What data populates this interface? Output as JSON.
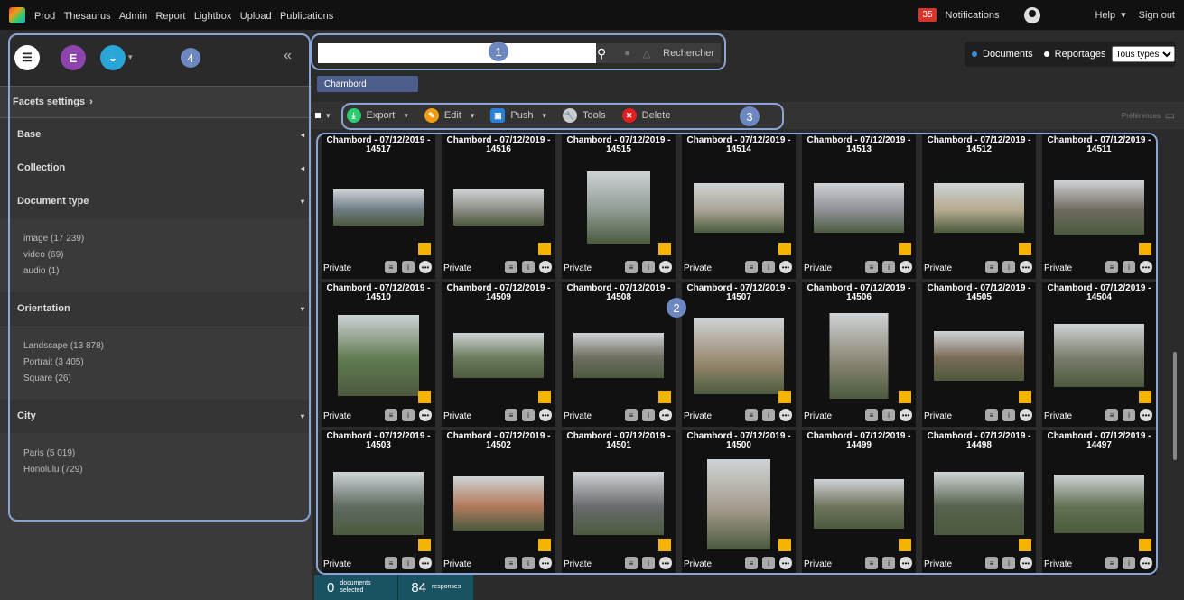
{
  "topbar": {
    "nav": [
      "Prod",
      "Thesaurus",
      "Admin",
      "Report",
      "Lightbox",
      "Upload",
      "Publications"
    ],
    "notifications_count": "35",
    "notifications_label": "Notifications",
    "help": "Help",
    "signout": "Sign out"
  },
  "annotations": {
    "n1": "1",
    "n2": "2",
    "n3": "3",
    "n4": "4"
  },
  "sidebar": {
    "facets_settings": "Facets settings",
    "collapse": "«",
    "facets": [
      {
        "label": "Base"
      },
      {
        "label": "Collection"
      },
      {
        "label": "Document type",
        "items": [
          "image (17 239)",
          "video (69)",
          "audio (1)"
        ]
      },
      {
        "label": "Orientation",
        "items": [
          "Landscape (13 878)",
          "Portrait (3 405)",
          "Square (26)"
        ]
      },
      {
        "label": "City",
        "items": [
          "Paris (5 019)",
          "Honolulu (729)"
        ]
      }
    ]
  },
  "search": {
    "placeholder": "",
    "button": "Rechercher"
  },
  "filters": {
    "documents": "Documents",
    "reportages": "Reportages",
    "type_select": "Tous types"
  },
  "active_chip": "Chambord",
  "toolbar": {
    "export": "Export",
    "edit": "Edit",
    "push": "Push",
    "tools": "Tools",
    "delete": "Delete",
    "preferences": "Préférences"
  },
  "results": {
    "cards": [
      {
        "t1": "Chambord - 07/12/2019 -",
        "t2": "14517",
        "priv": "Private"
      },
      {
        "t1": "Chambord - 07/12/2019 -",
        "t2": "14516",
        "priv": "Private"
      },
      {
        "t1": "Chambord - 07/12/2019 -",
        "t2": "14515",
        "priv": "Private"
      },
      {
        "t1": "Chambord - 07/12/2019 -",
        "t2": "14514",
        "priv": "Private"
      },
      {
        "t1": "Chambord - 07/12/2019 -",
        "t2": "14513",
        "priv": "Private"
      },
      {
        "t1": "Chambord - 07/12/2019 -",
        "t2": "14512",
        "priv": "Private"
      },
      {
        "t1": "Chambord - 07/12/2019 -",
        "t2": "14511",
        "priv": "Private"
      },
      {
        "t1": "Chambord - 07/12/2019 -",
        "t2": "14510",
        "priv": "Private"
      },
      {
        "t1": "Chambord - 07/12/2019 -",
        "t2": "14509",
        "priv": "Private"
      },
      {
        "t1": "Chambord - 07/12/2019 -",
        "t2": "14508",
        "priv": "Private"
      },
      {
        "t1": "Chambord - 07/12/2019 -",
        "t2": "14507",
        "priv": "Private"
      },
      {
        "t1": "Chambord - 07/12/2019 -",
        "t2": "14506",
        "priv": "Private"
      },
      {
        "t1": "Chambord - 07/12/2019 -",
        "t2": "14505",
        "priv": "Private"
      },
      {
        "t1": "Chambord - 07/12/2019 -",
        "t2": "14504",
        "priv": "Private"
      },
      {
        "t1": "Chambord - 07/12/2019 -",
        "t2": "14503",
        "priv": "Private"
      },
      {
        "t1": "Chambord - 07/12/2019 -",
        "t2": "14502",
        "priv": "Private"
      },
      {
        "t1": "Chambord - 07/12/2019 -",
        "t2": "14501",
        "priv": "Private"
      },
      {
        "t1": "Chambord - 07/12/2019 -",
        "t2": "14500",
        "priv": "Private"
      },
      {
        "t1": "Chambord - 07/12/2019 -",
        "t2": "14499",
        "priv": "Private"
      },
      {
        "t1": "Chambord - 07/12/2019 -",
        "t2": "14498",
        "priv": "Private"
      },
      {
        "t1": "Chambord - 07/12/2019 -",
        "t2": "14497",
        "priv": "Private"
      }
    ]
  },
  "status": {
    "selected_count": "0",
    "selected_label": "documents selected",
    "responses_count": "84",
    "responses_label": "responses"
  }
}
